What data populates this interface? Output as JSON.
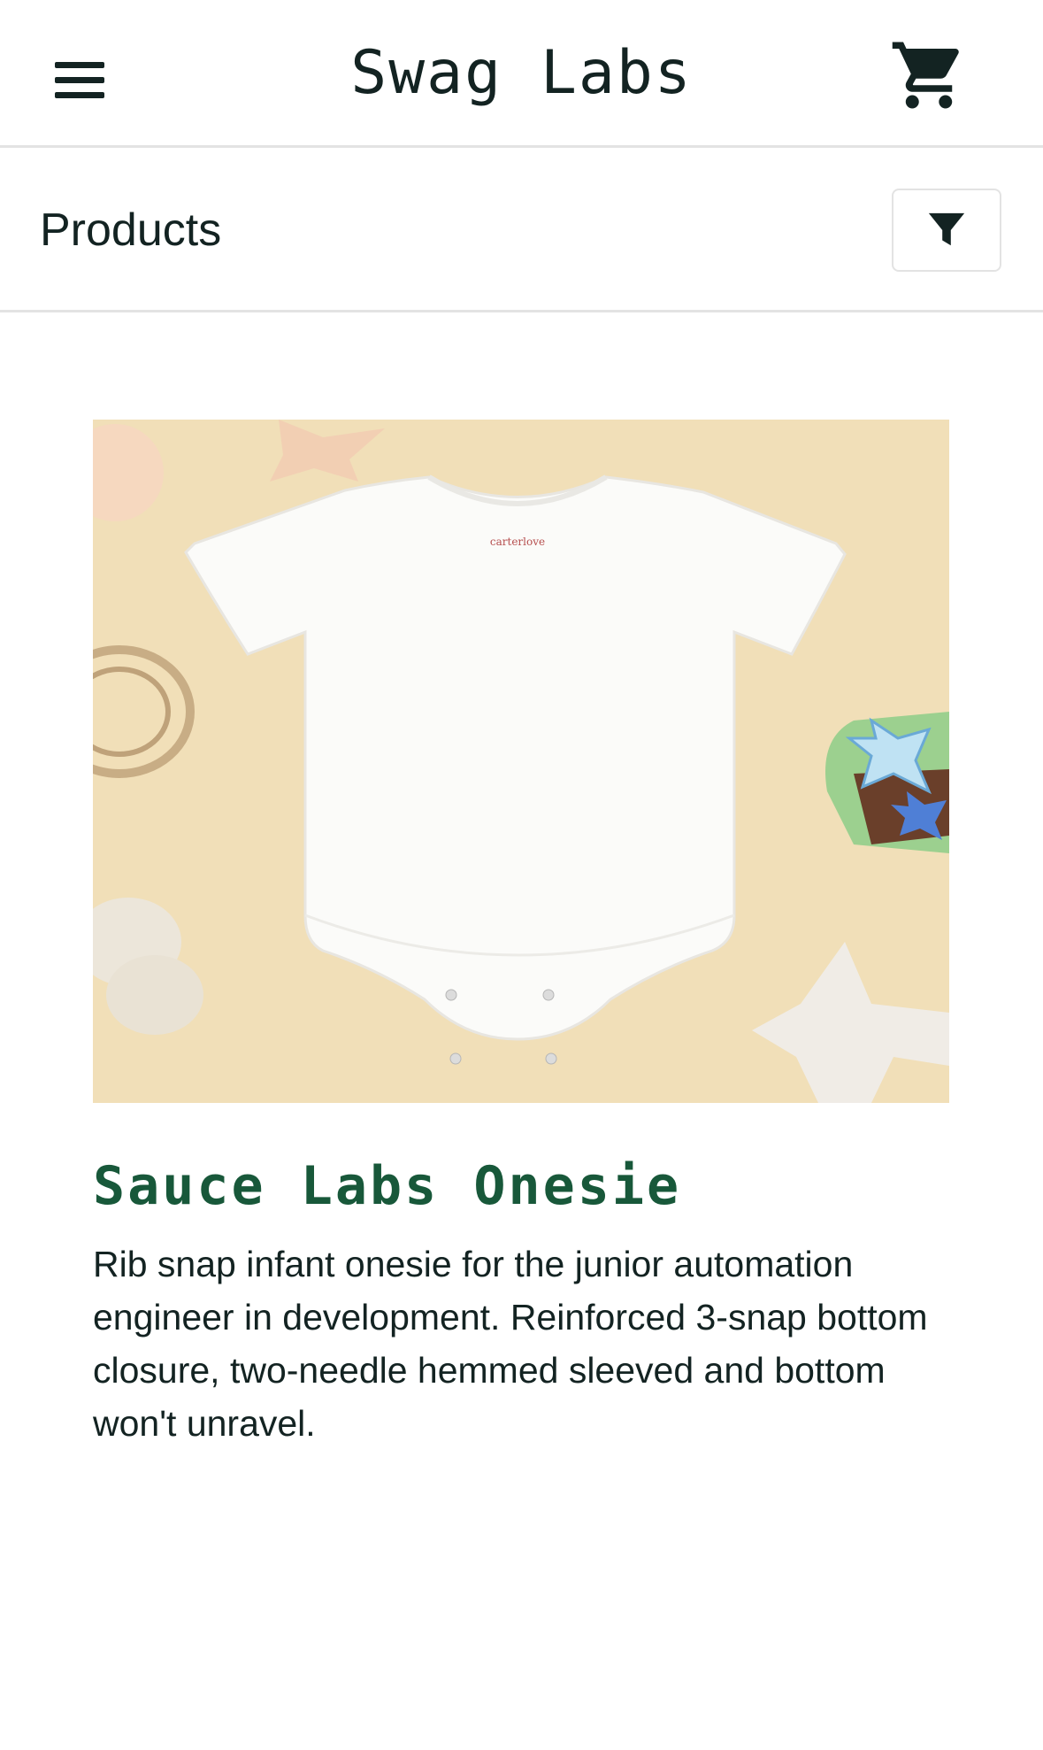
{
  "header": {
    "title": "Swag Labs",
    "menu_icon": "hamburger-menu-icon",
    "cart_icon": "shopping-cart-icon"
  },
  "subheader": {
    "title": "Products",
    "filter_icon": "filter-icon"
  },
  "product": {
    "name": "Sauce Labs Onesie",
    "description": "Rib snap infant onesie for the junior automation engineer in development. Reinforced 3-snap bottom closure, two-needle hemmed sleeved and bottom won't unravel.",
    "image_label": "carterlove"
  },
  "colors": {
    "accent_green": "#18583a",
    "text_dark": "#132322",
    "image_bg": "#f1dfb8"
  }
}
